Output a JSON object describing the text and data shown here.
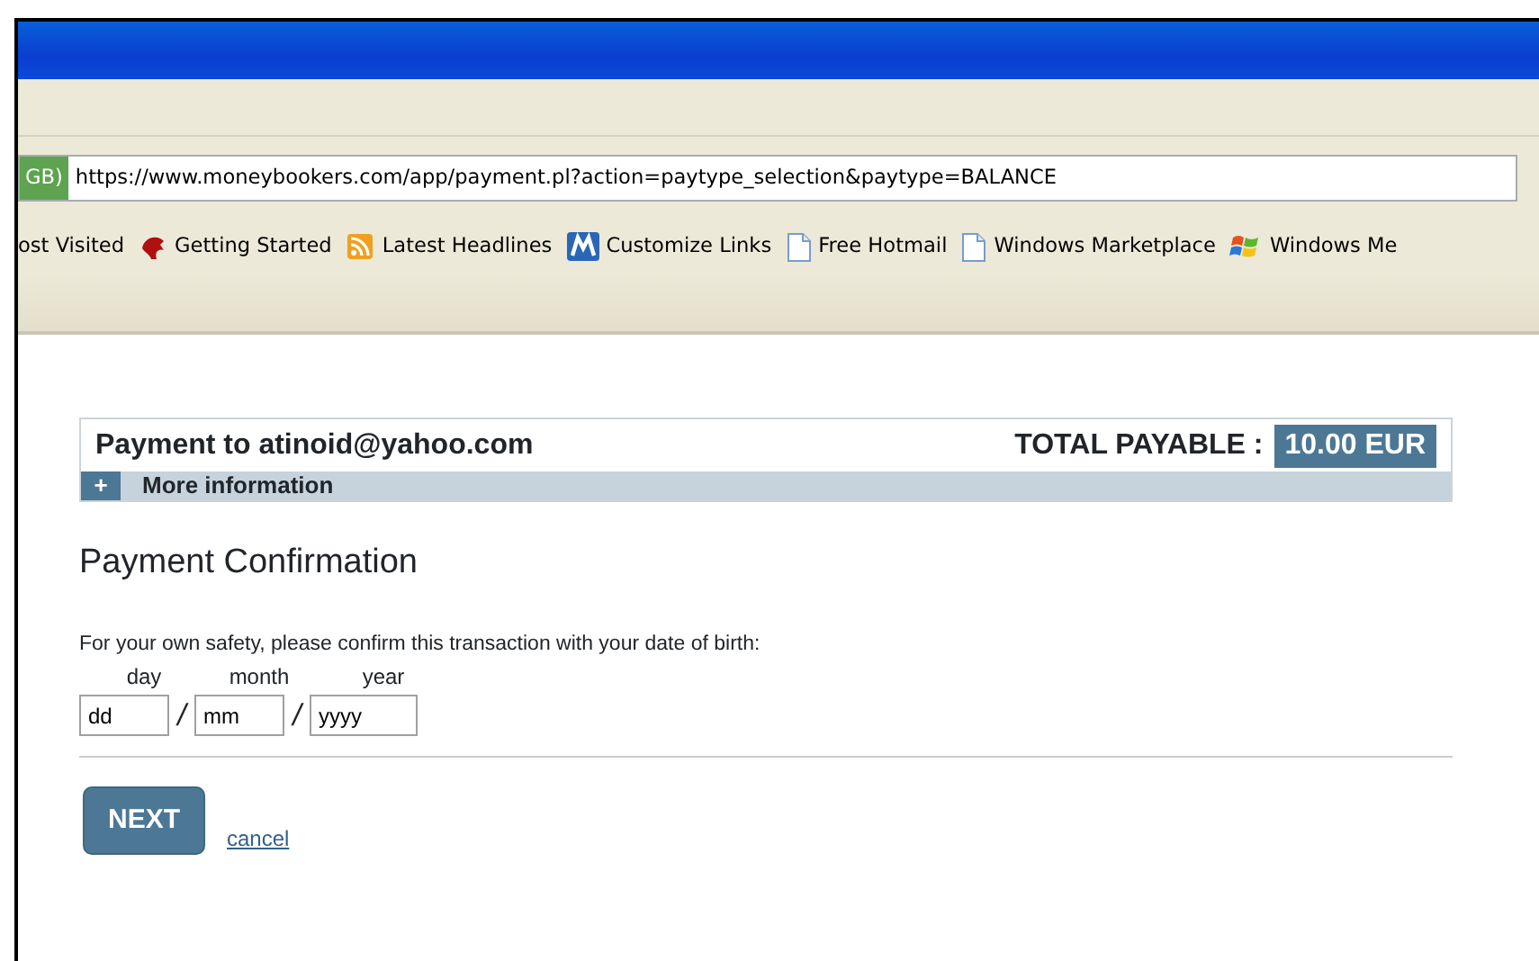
{
  "browser": {
    "security_tag": "GB)",
    "url": "https://www.moneybookers.com/app/payment.pl?action=paytype_selection&paytype=BALANCE",
    "bookmarks": [
      {
        "label": "ost Visited",
        "kind": "none"
      },
      {
        "label": "Getting Started",
        "kind": "bird"
      },
      {
        "label": "Latest Headlines",
        "kind": "feed"
      },
      {
        "label": "Customize Links",
        "kind": "tile"
      },
      {
        "label": "Free Hotmail",
        "kind": "page"
      },
      {
        "label": "Windows Marketplace",
        "kind": "page"
      },
      {
        "label": "Windows Me",
        "kind": "flag"
      }
    ]
  },
  "summary": {
    "payee": "Payment to atinoid@yahoo.com",
    "total_label": "TOTAL PAYABLE :",
    "total": "10.00 EUR",
    "toggle": "+",
    "more": "More information"
  },
  "heading": "Payment Confirmation",
  "instruction": "For your own safety, please confirm this transaction with your date of birth:",
  "date_fields": [
    {
      "label": "day",
      "value": "dd"
    },
    {
      "label": "month",
      "value": "mm"
    },
    {
      "label": "year",
      "value": "yyyy"
    }
  ],
  "separator": "/",
  "next_button": "NEXT",
  "cancel_link": "cancel"
}
